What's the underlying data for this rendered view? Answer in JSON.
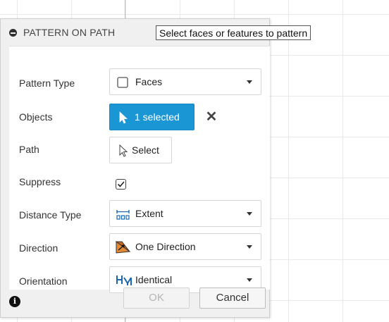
{
  "dialog": {
    "title": "PATTERN ON PATH",
    "tooltip": "Select faces or features to pattern"
  },
  "rows": {
    "pattern_type": {
      "label": "Pattern Type",
      "value": "Faces",
      "icon": "face-checkbox-icon"
    },
    "objects": {
      "label": "Objects",
      "value": "1 selected",
      "icon": "cursor-arrow-icon",
      "accent": "#1a96d4"
    },
    "path": {
      "label": "Path",
      "value": "Select",
      "icon": "cursor-arrow-icon"
    },
    "suppress": {
      "label": "Suppress",
      "checked": true
    },
    "distance_type": {
      "label": "Distance Type",
      "value": "Extent",
      "icon": "extent-icon"
    },
    "direction": {
      "label": "Direction",
      "value": "One Direction",
      "icon": "one-direction-icon"
    },
    "orientation": {
      "label": "Orientation",
      "value": "Identical",
      "icon": "identical-icon"
    }
  },
  "footer": {
    "ok_label": "OK",
    "cancel_label": "Cancel",
    "info_glyph": "i"
  }
}
